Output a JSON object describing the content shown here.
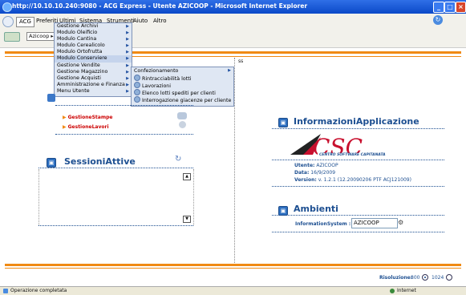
{
  "window": {
    "title": "http://10.10.10.240:9080 - ACG Express - Utente AZICOOP - Microsoft Internet Explorer"
  },
  "toolbar": {
    "menus": [
      "ACG",
      "Preferiti",
      "Ultimi",
      "Sistema",
      "Strumenti",
      "Aiuto",
      "Altro"
    ],
    "azicoop_label": "Azicoop"
  },
  "main_menu": {
    "items": [
      "Gestione Archivi",
      "Modulo Oleificio",
      "Modulo Cantina",
      "Modulo Cerealicolo",
      "Modulo Ortofrutta",
      "Modulo Conserviere",
      "Gestione Vendite",
      "Gestione Magazzino",
      "Gestione Acquisti",
      "Amministrazione e Finanza",
      "Menu Utente"
    ]
  },
  "sub_menu": {
    "items": [
      "Confezionamento",
      "Rintracciabilità lotti",
      "Lavorazioni",
      "Elenco lotti spediti per clienti",
      "Interrogazione giacenze per cliente"
    ]
  },
  "page": {
    "ss_label": "ss",
    "links": [
      "GestioneStampe",
      "GestioneLavori"
    ],
    "sessioni_title": "SessioniAttive",
    "info_title": "InformazioniApplicazione",
    "logo_text": "CSC",
    "logo_subtitle": "CENTRO SOFTWARE CAPITANATA",
    "utente_label": "Utente:",
    "utente_value": "AZICOOP",
    "data_label": "Data:",
    "data_value": "16/9/2009",
    "versione_label": "Version:",
    "versione_value": "v. 1.2.1 (12.20090206 PTF ACJ121009)",
    "ambienti_title": "Ambienti",
    "info_system_label": "InformationSystem :",
    "info_system_value": "AZICOOP",
    "risoluzione_label": "Risoluzione:",
    "res_800": "800",
    "res_1024": "1024"
  },
  "status": {
    "left_text": "Operazione completata",
    "right_text": "Internet"
  },
  "colors": {
    "accent_orange": "#f08a14",
    "header_blue": "#1d4f91",
    "logo_red": "#c8102e"
  }
}
